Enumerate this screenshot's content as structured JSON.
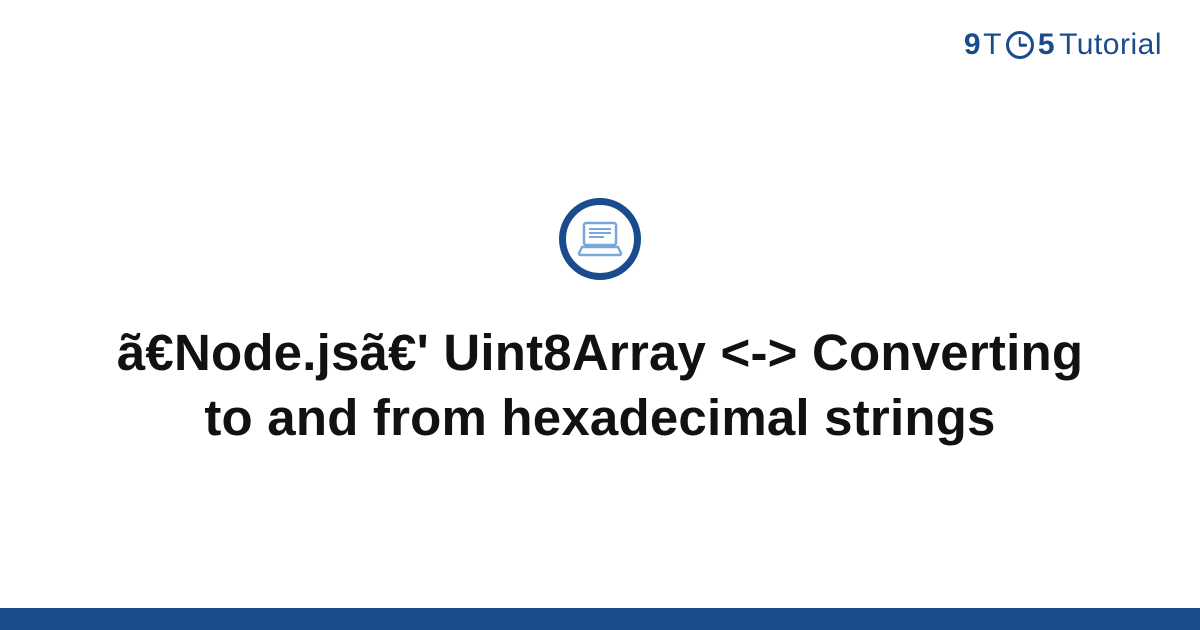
{
  "brand": {
    "nine": "9",
    "t1": "T",
    "five": "5",
    "tutorial": "Tutorial"
  },
  "hero": {
    "title": "ã€Node.jsã€' Uint8Array <-> Converting to and from hexadecimal strings"
  },
  "colors": {
    "primary": "#1a4b8c"
  }
}
